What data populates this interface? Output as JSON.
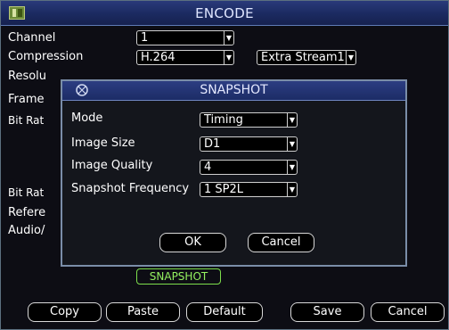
{
  "window": {
    "title": "ENCODE",
    "labels": {
      "channel": "Channel",
      "compression": "Compression",
      "resolution": "Resolu",
      "frame_rate": "Frame",
      "bit_rate_type": "Bit Rat",
      "bit_rate": "Bit Rat",
      "reference": "Refere",
      "audio": "Audio/"
    },
    "fields": {
      "channel": "1",
      "compression": "H.264",
      "extra_stream": "Extra Stream1"
    },
    "buttons": {
      "copy": "Copy",
      "paste": "Paste",
      "default": "Default",
      "save": "Save",
      "cancel": "Cancel"
    }
  },
  "snapshot_button": "SNAPSHOT",
  "dialog": {
    "title": "SNAPSHOT",
    "rows": [
      {
        "label": "Mode",
        "value": "Timing"
      },
      {
        "label": "Image Size",
        "value": "D1"
      },
      {
        "label": "Image Quality",
        "value": "4"
      },
      {
        "label": "Snapshot Frequency",
        "value": "1 SP2L"
      }
    ],
    "ok": "OK",
    "cancel": "Cancel"
  },
  "icons": {
    "app": "app-icon",
    "dialog": "snapshot-dialog-icon",
    "dropdown": "chevron-down-icon"
  }
}
